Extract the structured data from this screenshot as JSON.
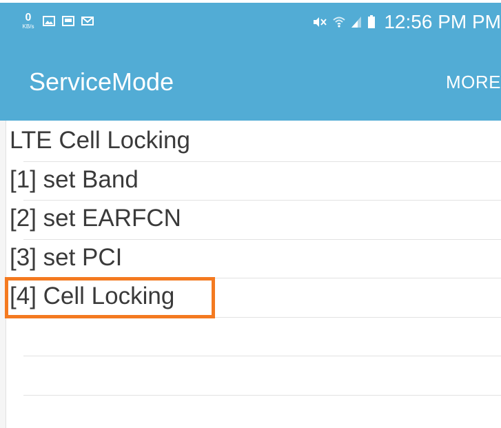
{
  "status_bar": {
    "net_speed_value": "0",
    "net_speed_unit": "KB/s",
    "icons_left": [
      "gallery-icon",
      "screen-icon",
      "mail-icon"
    ],
    "icons_right": [
      "mute-icon",
      "wifi-icon",
      "signal-icon",
      "battery-icon"
    ],
    "time": "12:56 PM PM",
    "bg_color": "#52acd5"
  },
  "app_bar": {
    "title": "ServiceMode",
    "more_label": "MORE"
  },
  "menu": {
    "items": [
      {
        "label": "LTE Cell Locking"
      },
      {
        "label": "[1] set Band"
      },
      {
        "label": "[2] set EARFCN"
      },
      {
        "label": "[3] set PCI"
      },
      {
        "label": "[4] Cell Locking"
      },
      {
        "label": ""
      },
      {
        "label": ""
      },
      {
        "label": ""
      }
    ],
    "highlighted_index": 4,
    "highlight_color": "#f47a20"
  }
}
